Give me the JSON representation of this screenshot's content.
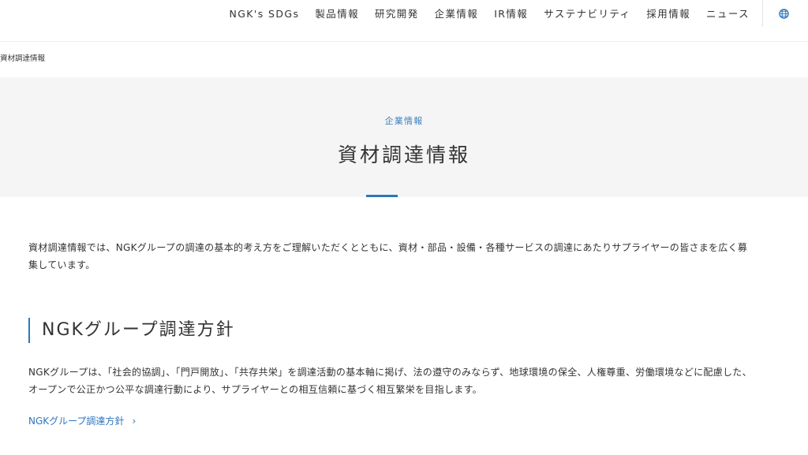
{
  "nav": {
    "items": [
      "NGK's SDGs",
      "製品情報",
      "研究開発",
      "企業情報",
      "IR情報",
      "サステナビリティ",
      "採用情報",
      "ニュース"
    ],
    "globe_icon": "globe-icon"
  },
  "breadcrumb": "資材調達情報",
  "hero": {
    "category": "企業情報",
    "title": "資材調達情報"
  },
  "intro": "資材調達情報では、NGKグループの調達の基本的考え方をご理解いただくとともに、資材・部品・設備・各種サービスの調達にあたりサプライヤーの皆さまを広く募集しています。",
  "section": {
    "title": "NGKグループ調達方針",
    "text": "NGKグループは、「社会的協調」、「門戸開放」、「共存共栄」を調達活動の基本軸に掲げ、法の遵守のみならず、地球環境の保全、人権尊重、労働環境などに配慮した、オープンで公正かつ公平な調達行動により、サプライヤーとの相互信頼に基づく相互繁栄を目指します。",
    "link": "NGKグループ調達方針",
    "link_icon": "chevron-right-icon"
  },
  "colors": {
    "accent": "#2d76bd",
    "hero_bg": "#f5f5f5",
    "text": "#333333"
  }
}
